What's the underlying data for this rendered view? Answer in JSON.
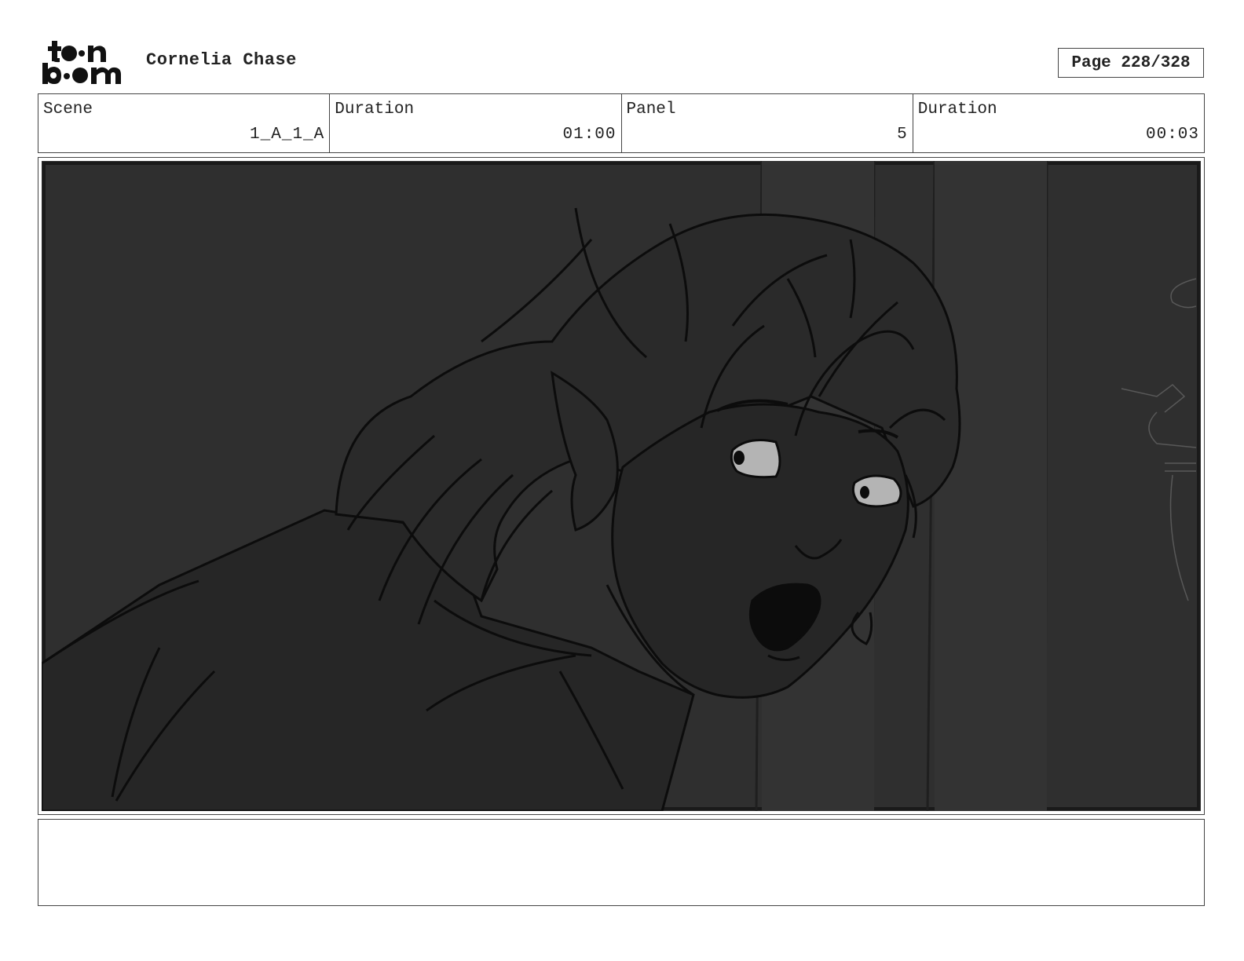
{
  "header": {
    "logo_text": "toon boom",
    "project_title": "Cornelia Chase",
    "page_label": "Page 228/328"
  },
  "info": {
    "scene_label": "Scene",
    "scene_value": "1_A_1_A",
    "scene_duration_label": "Duration",
    "scene_duration_value": "01:00",
    "panel_label": "Panel",
    "panel_value": "5",
    "panel_duration_label": "Duration",
    "panel_duration_value": "00:03"
  },
  "panel": {
    "image_icon": "storyboard-panel-drawing",
    "background_color": "#2e2e2e"
  },
  "notes": {
    "text": ""
  }
}
